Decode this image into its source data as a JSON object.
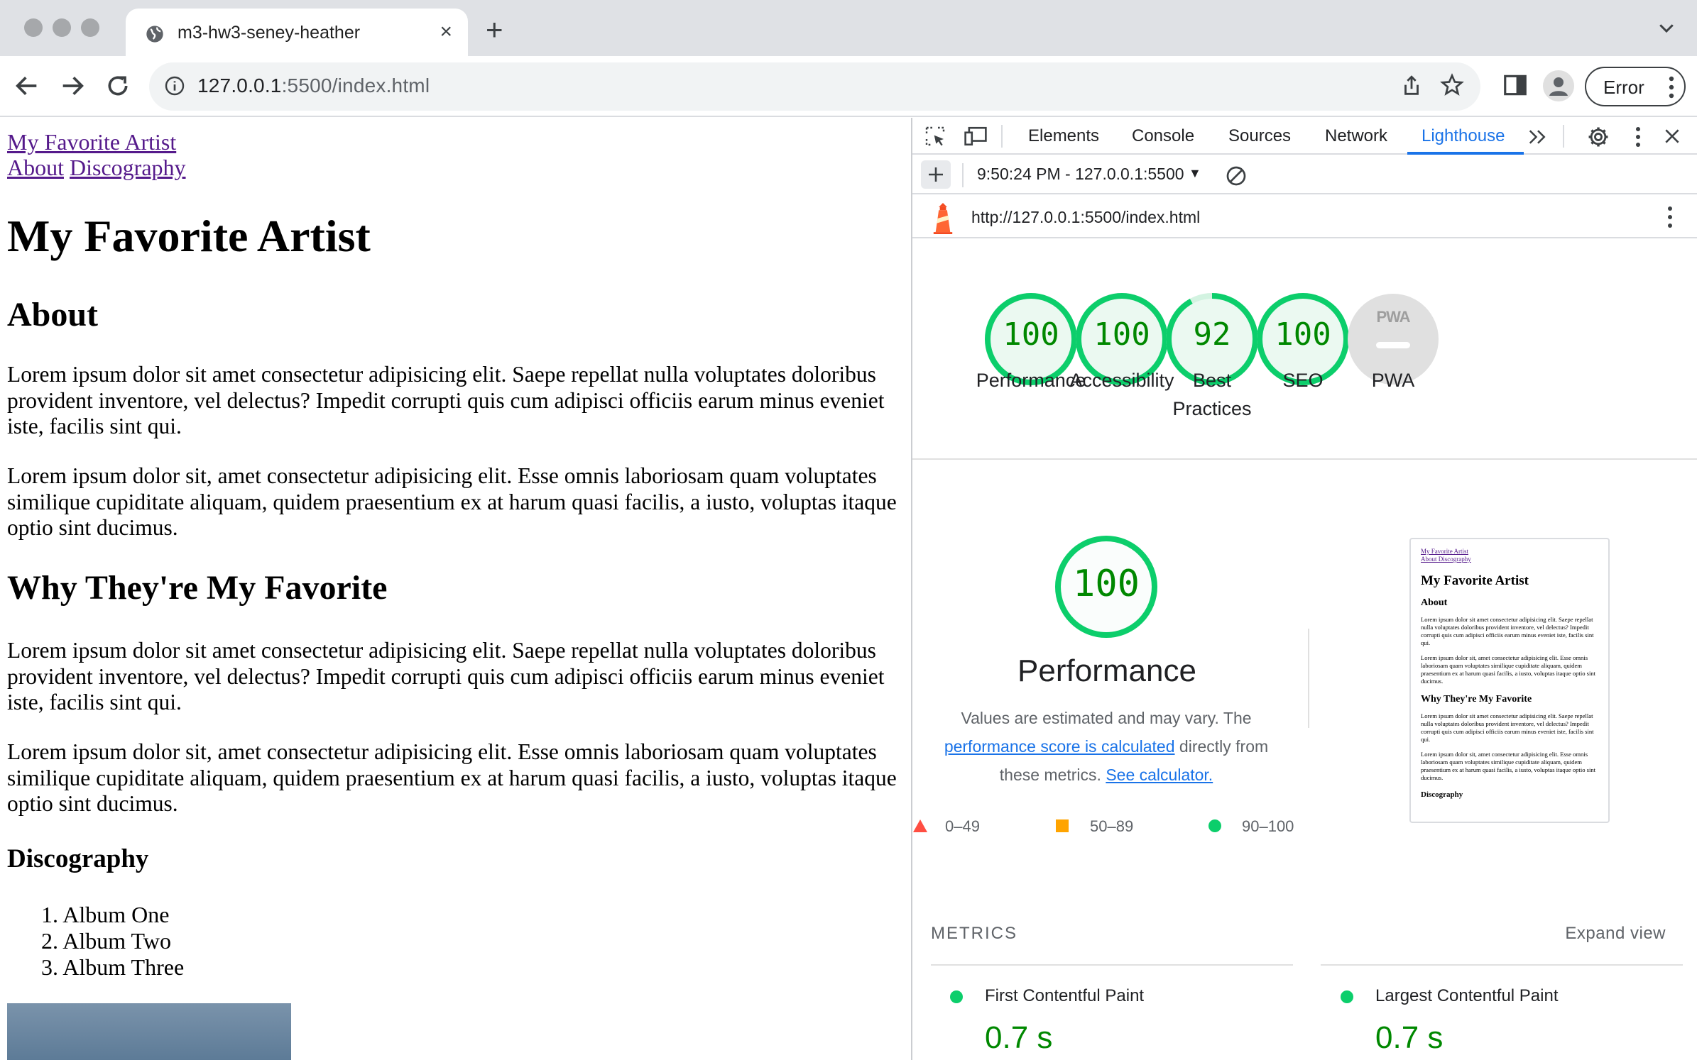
{
  "browser": {
    "tab_title": "m3-hw3-seney-heather",
    "url_host": "127.0.0.1",
    "url_rest": ":5500/index.html",
    "profile_button_label": "Error"
  },
  "page": {
    "nav_title_link": "My Favorite Artist",
    "nav_about_link": "About",
    "nav_discography_link": "Discography",
    "heading": "My Favorite Artist",
    "about_heading": "About",
    "about_p1": "Lorem ipsum dolor sit amet consectetur adipisicing elit. Saepe repellat nulla voluptates doloribus provident inventore, vel delectus? Impedit corrupti quis cum adipisci officiis earum minus eveniet iste, facilis sint qui.",
    "about_p2": "Lorem ipsum dolor sit, amet consectetur adipisicing elit. Esse omnis laboriosam quam voluptates similique cupiditate aliquam, quidem praesentium ex at harum quasi facilis, a iusto, voluptas itaque optio sint ducimus.",
    "why_heading": "Why They're My Favorite",
    "why_p1": "Lorem ipsum dolor sit amet consectetur adipisicing elit. Saepe repellat nulla voluptates doloribus provident inventore, vel delectus? Impedit corrupti quis cum adipisci officiis earum minus eveniet iste, facilis sint qui.",
    "why_p2": "Lorem ipsum dolor sit, amet consectetur adipisicing elit. Esse omnis laboriosam quam voluptates similique cupiditate aliquam, quidem praesentium ex at harum quasi facilis, a iusto, voluptas itaque optio sint ducimus.",
    "discography_heading": "Discography",
    "albums": [
      "1. Album One",
      "2. Album Two",
      "3. Album Three"
    ]
  },
  "devtools": {
    "tabs": [
      "Elements",
      "Console",
      "Sources",
      "Network",
      "Lighthouse"
    ],
    "active_tab": "Lighthouse",
    "report_time": "9:50:24 PM - 127.0.0.1:5500",
    "report_url": "http://127.0.0.1:5500/index.html",
    "scores": [
      {
        "label": "Performance",
        "value": "100",
        "score": 100
      },
      {
        "label": "Accessibility",
        "value": "100",
        "score": 100
      },
      {
        "label": "Best Practices",
        "value": "92",
        "score": 92
      },
      {
        "label": "SEO",
        "value": "100",
        "score": 100
      },
      {
        "label": "PWA",
        "value": "",
        "score": null
      }
    ],
    "pwa_badge": "PWA",
    "perf_score": "100",
    "perf_title": "Performance",
    "perf_desc_1": "Values are estimated and may vary. The",
    "perf_desc_link1": "performance score is calculated",
    "perf_desc_2": "directly from",
    "perf_desc_3": "these metrics.",
    "perf_desc_link2": "See calculator.",
    "legend": [
      "0–49",
      "50–89",
      "90–100"
    ],
    "thumbnail": {
      "links": "My Favorite Artist",
      "links2": "About Discography",
      "h1": "My Favorite Artist",
      "about": "About",
      "p1": "Lorem ipsum dolor sit amet consectetur adipisicing elit. Saepe repellat nulla voluptates doloribus provident inventore, vel delectus? Impedit corrupti quis cum adipisci officiis earum minus eveniet iste, facilis sint qui.",
      "p2": "Lorem ipsum dolor sit, amet consectetur adipisicing elit. Esse omnis laboriosam quam voluptates similique cupiditate aliquam, quidem praesentium ex at harum quasi facilis, a iusto, voluptas itaque optio sint ducimus.",
      "why": "Why They're My Favorite",
      "p3": "Lorem ipsum dolor sit amet consectetur adipisicing elit. Saepe repellat nulla voluptates doloribus provident inventore, vel delectus? Impedit corrupti quis cum adipisci officiis earum minus eveniet iste, facilis sint qui.",
      "p4": "Lorem ipsum dolor sit, amet consectetur adipisicing elit. Esse omnis laboriosam quam voluptates similique cupiditate aliquam, quidem praesentium ex at harum quasi facilis, a iusto, voluptas itaque optio sint ducimus.",
      "disc": "Discography"
    },
    "metrics_header": "METRICS",
    "expand_view": "Expand view",
    "metrics": [
      {
        "name": "First Contentful Paint",
        "value": "0.7 s"
      },
      {
        "name": "Largest Contentful Paint",
        "value": "0.7 s"
      }
    ]
  },
  "colors": {
    "pass": "#0cce6b",
    "pass_text": "#008800",
    "average": "#ffa400",
    "fail": "#ff4e42",
    "accent": "#1a73e8"
  }
}
